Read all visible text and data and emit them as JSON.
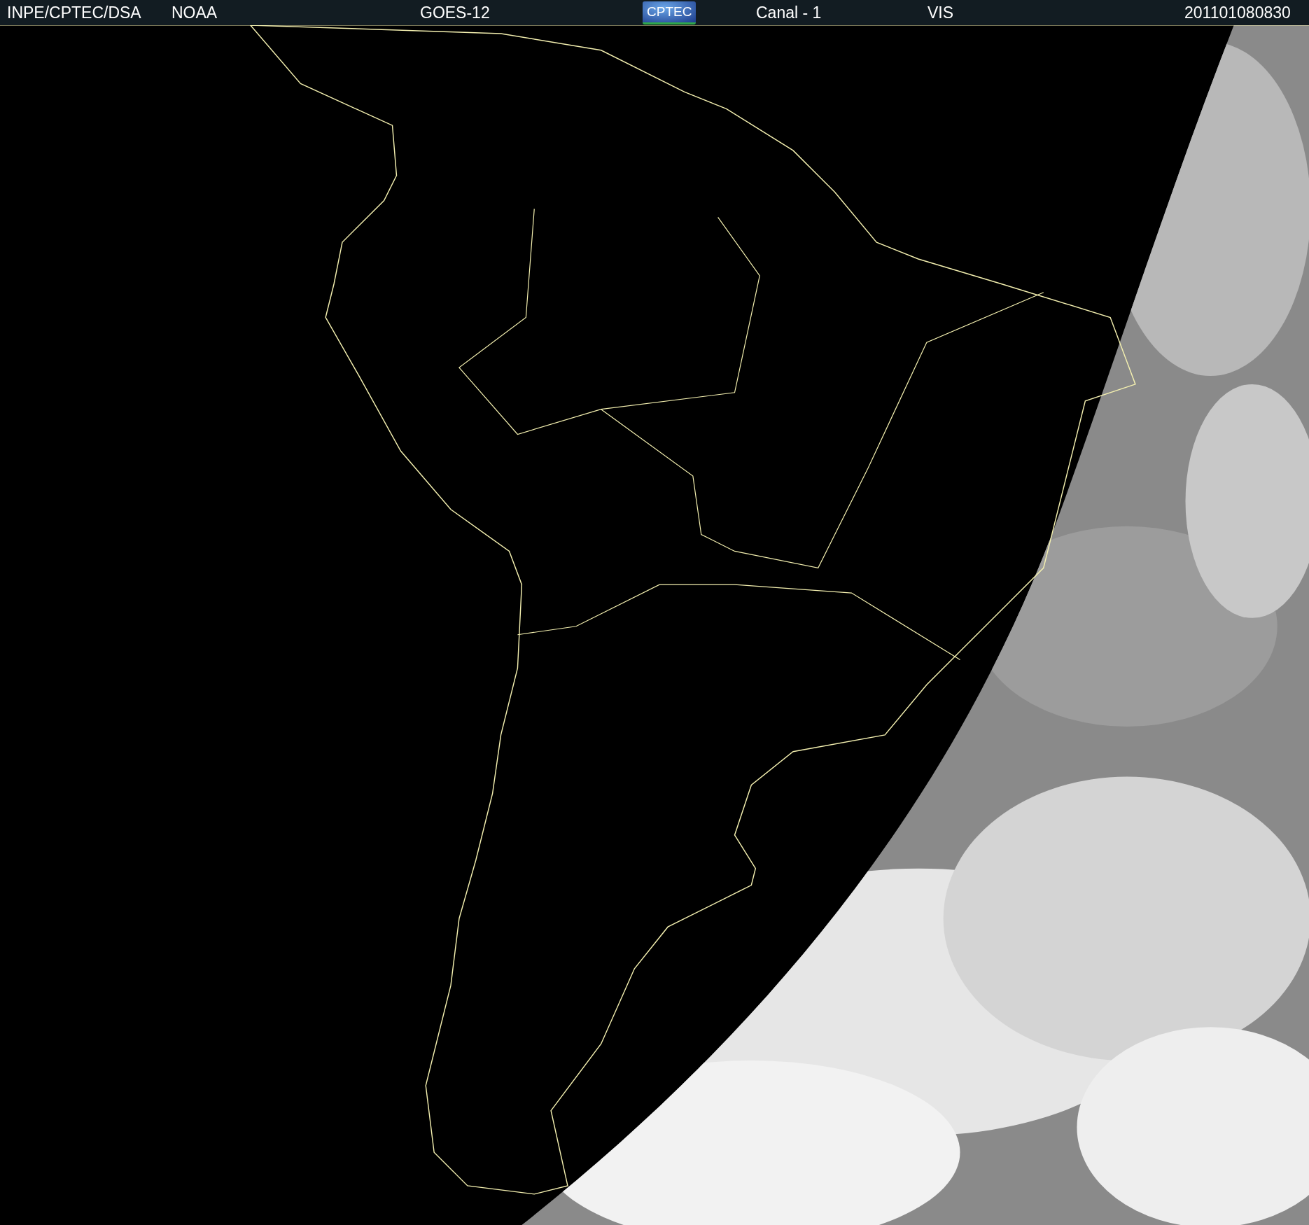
{
  "header": {
    "items": [
      {
        "kind": "text",
        "text": "INPE/CPTEC/DSA"
      },
      {
        "kind": "text",
        "text": "NOAA"
      },
      {
        "kind": "text",
        "text": "GOES-12"
      },
      {
        "kind": "logo",
        "text": "CPTEC"
      },
      {
        "kind": "text",
        "text": "Canal - 1"
      },
      {
        "kind": "text",
        "text": "VIS"
      },
      {
        "kind": "text",
        "text": "201101080830"
      }
    ]
  }
}
